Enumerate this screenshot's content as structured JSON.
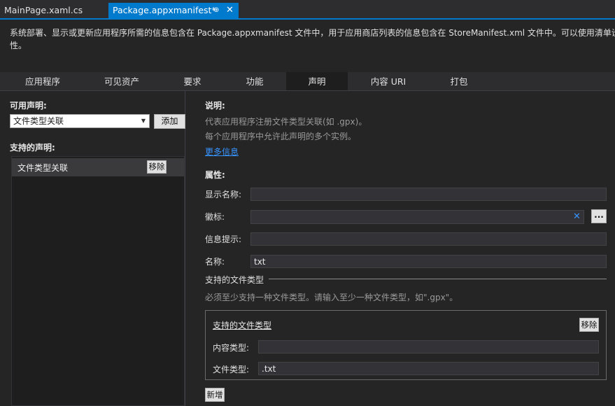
{
  "doc_tabs": {
    "inactive_label": "MainPage.xaml.cs",
    "active_label": "Package.appxmanifest*",
    "pin_glyph": "⊕",
    "close_glyph": "✕"
  },
  "description": {
    "line1": "系统部署、显示或更新应用程序所需的信息包含在 Package.appxmanifest 文件中，用于应用商店列表的信息包含在 StoreManifest.xml 文件中。可以使用清单设",
    "line2": "性。"
  },
  "nav_tabs": [
    {
      "label": "应用程序"
    },
    {
      "label": "可见资产"
    },
    {
      "label": "要求"
    },
    {
      "label": "功能"
    },
    {
      "label": "声明"
    },
    {
      "label": "内容 URI"
    },
    {
      "label": "打包"
    }
  ],
  "left": {
    "available_label": "可用声明:",
    "selected_declaration": "文件类型关联",
    "add_button": "添加",
    "supported_label": "支持的声明:",
    "supported_items": [
      {
        "label": "文件类型关联",
        "remove": "移除"
      }
    ]
  },
  "right": {
    "info_heading": "说明:",
    "info_line1": "代表应用程序注册文件类型关联(如 .gpx)。",
    "info_line2": "每个应用程序中允许此声明的多个实例。",
    "more_info_link": "更多信息",
    "props_heading": "属性:",
    "display_name_label": "显示名称:",
    "display_name_value": "",
    "logo_label": "徽标:",
    "logo_value": "",
    "logo_clear": "✕",
    "logo_browse": "...",
    "infotip_label": "信息提示:",
    "infotip_value": "",
    "name_label": "名称:",
    "name_value": "txt",
    "supported_types_heading": "支持的文件类型",
    "supported_types_hint": "必须至少支持一种文件类型。请输入至少一种文件类型，如\".gpx\"。",
    "group_title": "支持的文件类型",
    "group_remove": "移除",
    "content_type_label": "内容类型:",
    "content_type_value": "",
    "file_type_label": "文件类型:",
    "file_type_value": ".txt",
    "add_new_button": "新增"
  }
}
